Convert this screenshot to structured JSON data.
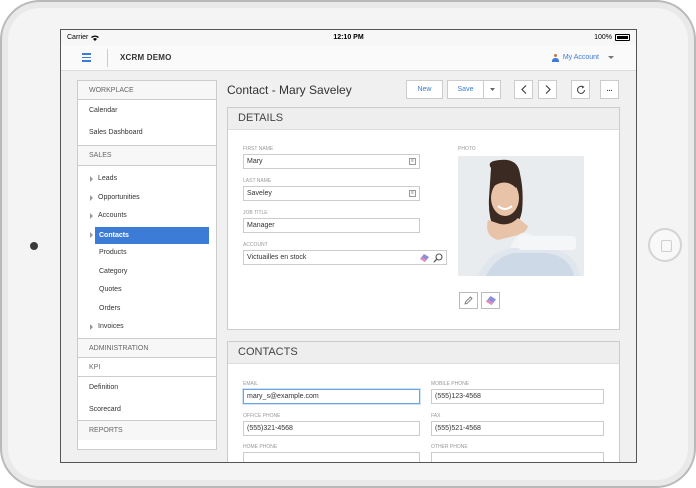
{
  "status_bar": {
    "carrier": "Carrier",
    "time": "12:10 PM",
    "battery": "100%"
  },
  "app": {
    "title": "XCRM DEMO",
    "account_label": "My Account"
  },
  "sidebar": {
    "workplace_header": "WORKPLACE",
    "workplace_items": [
      "Calendar",
      "Sales Dashboard"
    ],
    "sales_header": "SALES",
    "sales_items": [
      "Leads",
      "Opportunities",
      "Accounts",
      "Contacts",
      "Products",
      "Category",
      "Quotes",
      "Orders",
      "Invoices"
    ],
    "admin_header": "ADMINISTRATION",
    "kpi_header": "KPI",
    "kpi_items": [
      "Definition",
      "Scorecard"
    ],
    "reports_header": "REPORTS"
  },
  "page": {
    "title": "Contact - Mary Saveley"
  },
  "toolbar": {
    "new_label": "New",
    "save_label": "Save",
    "more_label": "..."
  },
  "details": {
    "header": "DETAILS",
    "first_name_label": "FIRST NAME",
    "first_name": "Mary",
    "last_name_label": "LAST NAME",
    "last_name": "Saveley",
    "job_title_label": "JOB TITLE",
    "job_title": "Manager",
    "account_label": "ACCOUNT",
    "account": "Victuailles en stock",
    "photo_label": "PHOTO"
  },
  "contacts": {
    "header": "CONTACTS",
    "email_label": "EMAIL",
    "email": "mary_s@example.com",
    "mobile_label": "MOBILE PHONE",
    "mobile": "(555)123-4568",
    "office_label": "OFFICE PHONE",
    "office": "(555)321-4568",
    "fax_label": "FAX",
    "fax": "(555)521-4568",
    "home_label": "HOME PHONE",
    "other_label": "OTHER PHONE"
  },
  "icons": [
    "wifi-icon",
    "battery-icon",
    "hamburger-menu-icon",
    "user-icon",
    "chevron-down-icon",
    "chevron-left-icon",
    "chevron-right-icon",
    "refresh-icon",
    "search-icon",
    "eraser-icon",
    "edit-icon"
  ],
  "colors": {
    "accent": "#3c7bd6"
  }
}
